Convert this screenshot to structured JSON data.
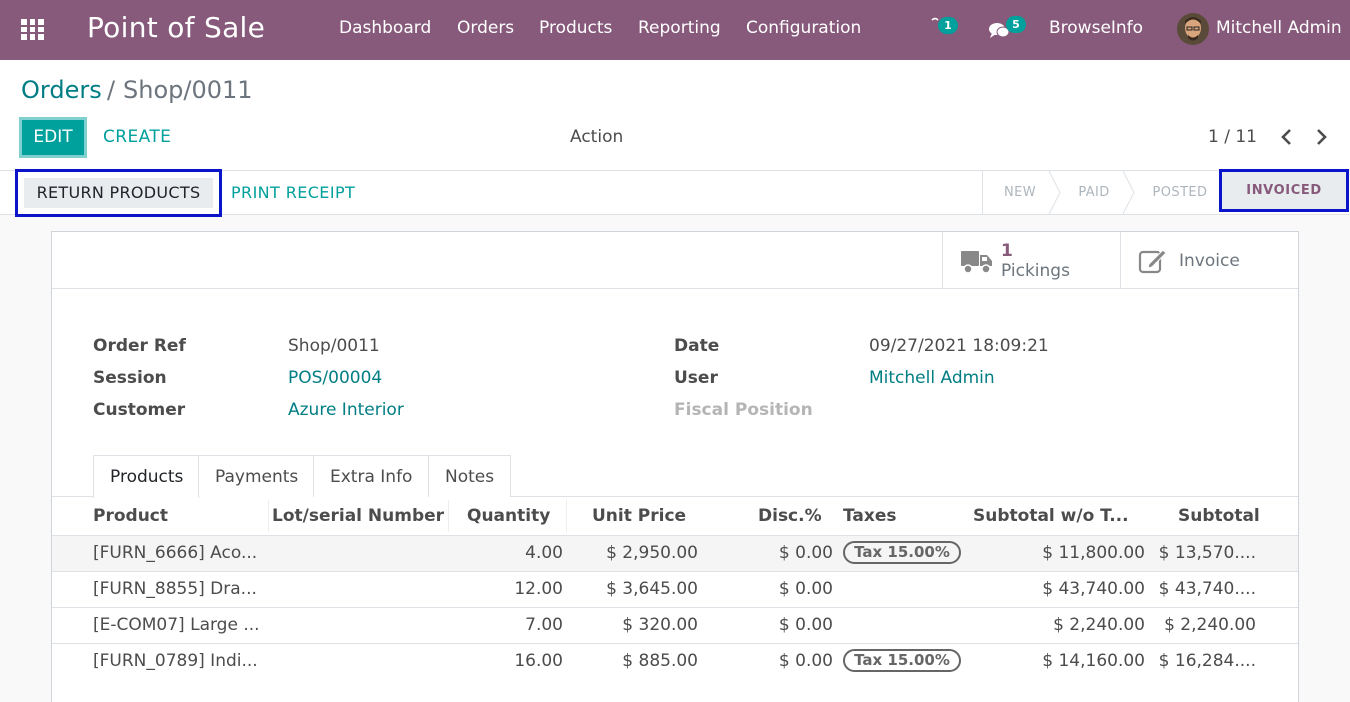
{
  "navbar": {
    "brand": "Point of Sale",
    "menu": [
      "Dashboard",
      "Orders",
      "Products",
      "Reporting",
      "Configuration"
    ],
    "activity_count": "1",
    "messages_count": "5",
    "company": "BrowseInfo",
    "user": "Mitchell Admin",
    "bg_color": "#875a7b"
  },
  "control_panel": {
    "breadcrumb_parent": "Orders",
    "breadcrumb_sep": "/",
    "breadcrumb_current": "Shop/0011",
    "edit_label": "EDIT",
    "create_label": "CREATE",
    "action_label": "Action",
    "pager": "1 / 11"
  },
  "statusbar": {
    "return_label": "RETURN PRODUCTS",
    "print_label": "PRINT RECEIPT",
    "stages": [
      "NEW",
      "PAID",
      "POSTED",
      "INVOICED"
    ],
    "current_stage": "INVOICED"
  },
  "smart_buttons": {
    "pickings_count": "1",
    "pickings_label": "Pickings",
    "invoice_label": "Invoice"
  },
  "form": {
    "order_ref_label": "Order Ref",
    "order_ref": "Shop/0011",
    "session_label": "Session",
    "session": "POS/00004",
    "customer_label": "Customer",
    "customer": "Azure Interior",
    "date_label": "Date",
    "date": "09/27/2021 18:09:21",
    "user_label": "User",
    "user": "Mitchell Admin",
    "fiscal_label": "Fiscal Position",
    "fiscal": ""
  },
  "tabs": [
    "Products",
    "Payments",
    "Extra Info",
    "Notes"
  ],
  "table": {
    "columns": [
      "Product",
      "Lot/serial Number",
      "Quantity",
      "Unit Price",
      "Disc.%",
      "Taxes",
      "Subtotal w/o T...",
      "Subtotal"
    ],
    "rows": [
      {
        "product": "[FURN_6666] Aco...",
        "lot": "",
        "qty": "4.00",
        "price": "$ 2,950.00",
        "disc": "$ 0.00",
        "tax": "Tax 15.00%",
        "subtotal_wo": "$ 11,800.00",
        "subtotal": "$ 13,570...."
      },
      {
        "product": "[FURN_8855] Dra...",
        "lot": "",
        "qty": "12.00",
        "price": "$ 3,645.00",
        "disc": "$ 0.00",
        "tax": "",
        "subtotal_wo": "$ 43,740.00",
        "subtotal": "$ 43,740...."
      },
      {
        "product": "[E-COM07] Large ...",
        "lot": "",
        "qty": "7.00",
        "price": "$ 320.00",
        "disc": "$ 0.00",
        "tax": "",
        "subtotal_wo": "$ 2,240.00",
        "subtotal": "$ 2,240.00"
      },
      {
        "product": "[FURN_0789] Indi...",
        "lot": "",
        "qty": "16.00",
        "price": "$ 885.00",
        "disc": "$ 0.00",
        "tax": "Tax 15.00%",
        "subtotal_wo": "$ 14,160.00",
        "subtotal": "$ 16,284...."
      }
    ]
  },
  "colors": {
    "primary": "#00a09d",
    "link": "#017e84",
    "highlight": "#0a14c8"
  }
}
